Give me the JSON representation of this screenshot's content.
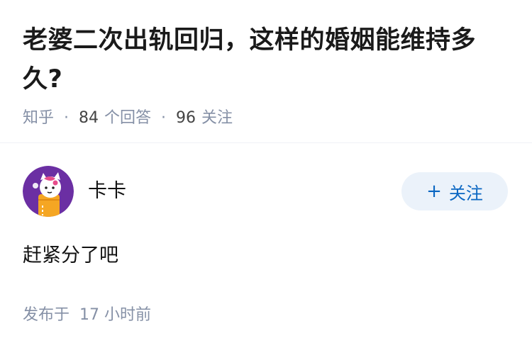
{
  "question": {
    "title": "老婆二次出轨回归，这样的婚姻能维持多久?",
    "source": "知乎",
    "answers_count": "84",
    "answers_label": "个回答",
    "followers_count": "96",
    "followers_label": "关注"
  },
  "answer": {
    "author_name": "卡卡",
    "avatar_icon": "cartoon-character-avatar-icon",
    "follow_label": "关注",
    "follow_icon": "plus-icon",
    "content": "赶紧分了吧",
    "time_prefix": "发布于",
    "time_value": "17 小时前"
  },
  "colors": {
    "accent": "#0a66c2",
    "follow_bg": "#ebf2fa",
    "muted_text": "#8590a6",
    "avatar_bg": "#6b2fa3"
  }
}
